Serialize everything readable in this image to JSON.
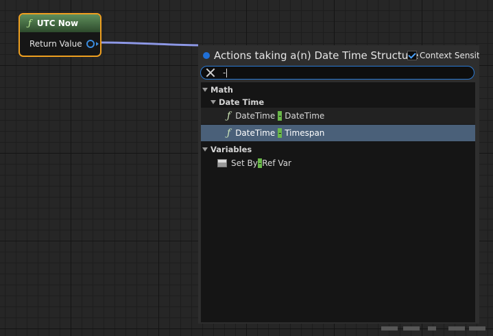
{
  "node": {
    "title": "UTC Now",
    "func_icon": "function-icon",
    "output_pin_label": "Return Value",
    "header_color": "#4c7c4a",
    "border_color": "#f0a020"
  },
  "menu": {
    "title": "Actions taking a(n) Date Time Structure",
    "context_sensitive_label": "Context Sensiti",
    "context_sensitive_checked": true,
    "search_value": "-",
    "accent_color": "#2b7bd6",
    "selected_color": "#4a6079",
    "match_highlight_color": "#6ab84a",
    "categories": [
      {
        "label": "Math"
      },
      {
        "label": "Date Time"
      },
      {
        "label": "Variables"
      }
    ],
    "items": [
      {
        "pre": "DateTime ",
        "match": "-",
        "post": " DateTime",
        "icon": "function-icon"
      },
      {
        "pre": "DateTime ",
        "match": "-",
        "post": " Timespan",
        "icon": "function-icon"
      },
      {
        "pre": "Set By",
        "match": "-",
        "post": "Ref Var",
        "icon": "variable-icon"
      }
    ]
  }
}
